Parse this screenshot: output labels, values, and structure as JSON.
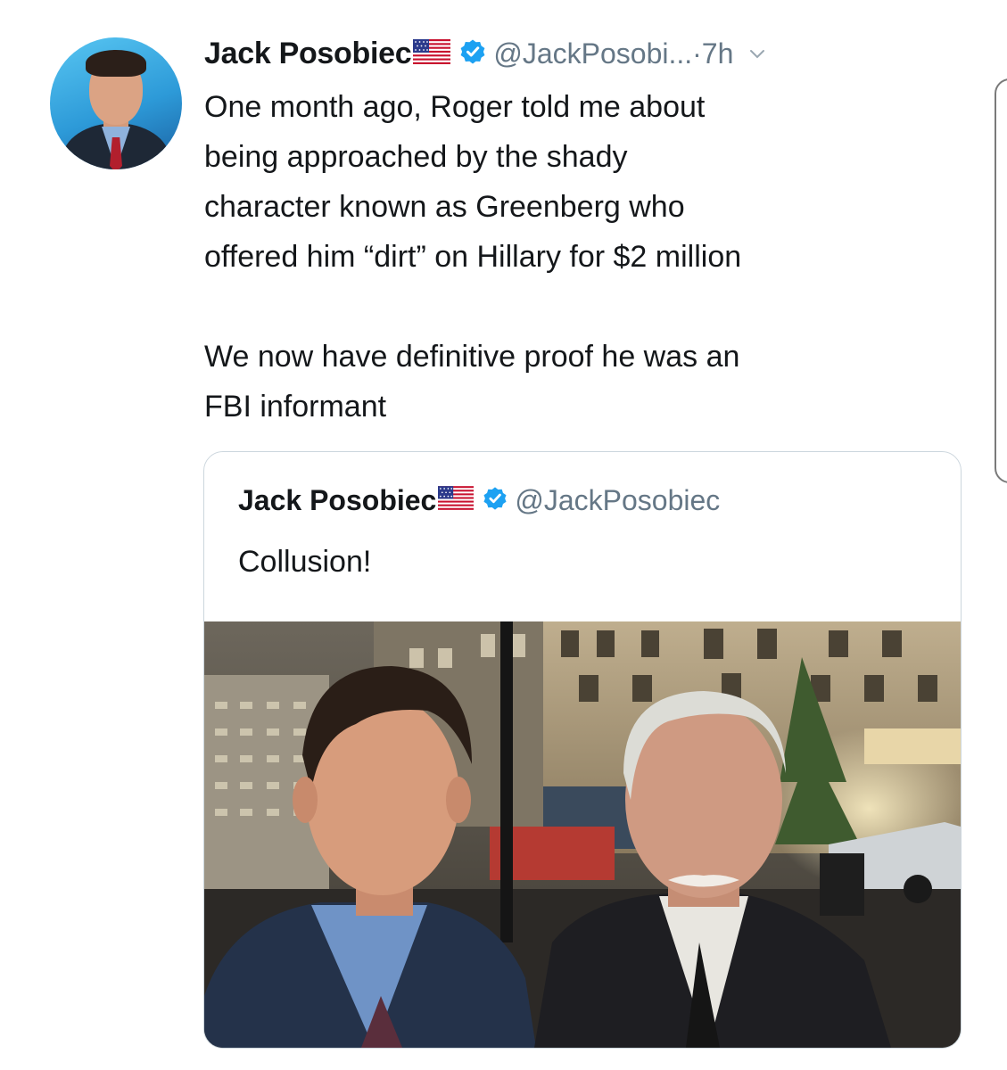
{
  "tweet": {
    "author_name": "Jack Posobiec",
    "handle": "@JackPosobi...",
    "separator": " · ",
    "time": "7h",
    "text": "One month ago, Roger told me about\nbeing approached by the shady\ncharacter known as Greenberg who\noffered him “dirt” on Hillary for $2 million\n\nWe now have definitive proof he was an\nFBI informant"
  },
  "quoted_tweet": {
    "author_name": "Jack Posobiec",
    "handle": "@JackPosobiec",
    "text": "Collusion!"
  },
  "icons": {
    "flag": "us-flag-icon",
    "verified": "verified-badge-icon",
    "caret": "chevron-down-icon"
  },
  "colors": {
    "text": "#14171a",
    "secondary_text": "#657786",
    "verified_blue": "#1da1f2",
    "border": "#ccd6dd"
  }
}
